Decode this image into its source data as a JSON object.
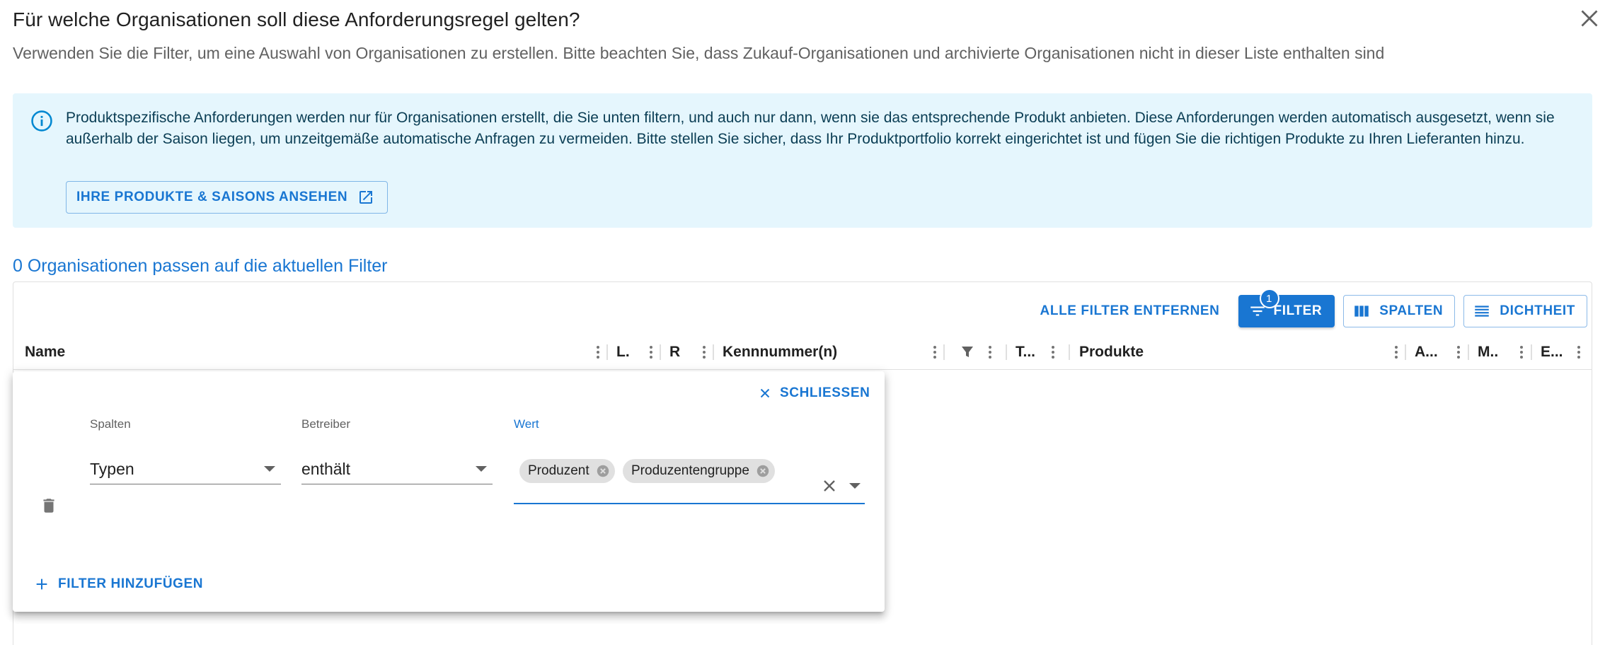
{
  "dialog": {
    "title": "Für welche Organisationen soll diese Anforderungsregel gelten?",
    "subtitle": "Verwenden Sie die Filter, um eine Auswahl von Organisationen zu erstellen. Bitte beachten Sie, dass Zukauf-Organisationen und archivierte Organisationen nicht in dieser Liste enthalten sind",
    "close_icon": "close-icon"
  },
  "info": {
    "icon": "info-icon",
    "text": "Produktspezifische Anforderungen werden nur für Organisationen erstellt, die Sie unten filtern, und auch nur dann, wenn sie das entsprechende Produkt anbieten. Diese Anforderungen werden automatisch ausgesetzt, wenn sie außerhalb der Saison liegen, um unzeitgemäße automatische Anfragen zu vermeiden. Bitte stellen Sie sicher, dass Ihr Produktportfolio korrekt eingerichtet ist und fügen Sie die richtigen Produkte zu Ihren Lieferanten hinzu.",
    "button_label": "IHRE PRODUKTE & SAISONS ANSEHEN"
  },
  "match_count": "0 Organisationen passen auf die aktuellen Filter",
  "toolbar": {
    "clear_filters": "ALLE FILTER ENTFERNEN",
    "filter_label": "FILTER",
    "filter_badge": "1",
    "columns_label": "SPALTEN",
    "density_label": "DICHTHEIT"
  },
  "columns": {
    "name": "Name",
    "l": "L.",
    "r": "R",
    "ids": "Kennnummer(n)",
    "t": "T...",
    "products": "Produkte",
    "a": "A...",
    "m": "M..",
    "e": "E..."
  },
  "filter_panel": {
    "close_label": "SCHLIESSEN",
    "columns_label": "Spalten",
    "operator_label": "Betreiber",
    "value_label": "Wert",
    "column_value": "Typen",
    "operator_value": "enthält",
    "chips": [
      "Produzent",
      "Produzentengruppe"
    ],
    "add_filter_label": "FILTER HINZUFÜGEN"
  },
  "colors": {
    "primary": "#1976d2",
    "info_bg": "#e5f6fd",
    "chip_bg": "#e0e0e0"
  }
}
